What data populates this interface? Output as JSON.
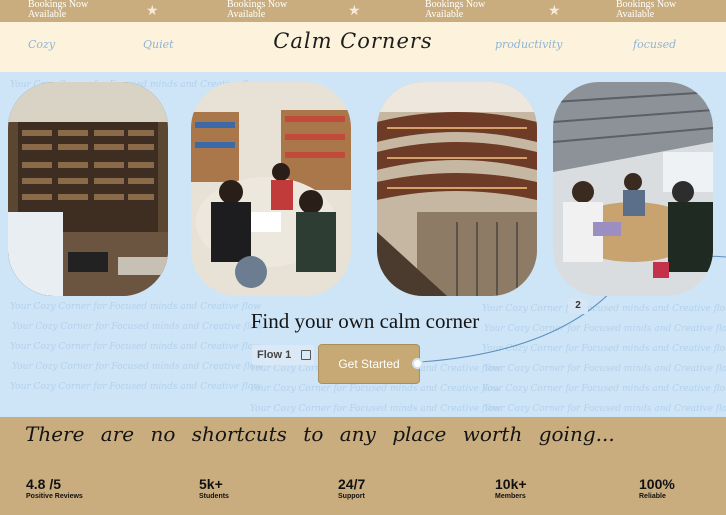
{
  "marquee": {
    "items": [
      "Bookings Now Available",
      "Bookings Now Available",
      "Bookings Now Available",
      "Bookings Now Available"
    ],
    "star": "★"
  },
  "nav": {
    "items": [
      "Cozy",
      "Quiet",
      "productivity",
      "focused"
    ],
    "brand": "Calm Corners"
  },
  "hero": {
    "background_text": "Your Cozy Corner for Focused minds and Creative flow",
    "title": "Find your own calm corner",
    "flow_label": "Flow 1",
    "cta_label": "Get Started",
    "badge": "2",
    "cards": [
      "library-octagon-photo",
      "students-group-photo",
      "library-circular-photo",
      "study-hall-photo"
    ]
  },
  "quote": "There are no shortcuts to any place worth going...",
  "stats": [
    {
      "value": "4.8 /5",
      "label": "Positive Reviews"
    },
    {
      "value": "5k+",
      "label": "Students"
    },
    {
      "value": "24/7",
      "label": "Support"
    },
    {
      "value": "10k+",
      "label": "Members"
    },
    {
      "value": "100%",
      "label": "Reliable"
    }
  ],
  "colors": {
    "tan": "#c9ad7e",
    "cream": "#fdf3dc",
    "sky": "#cde5f7",
    "cta": "#c6a974"
  }
}
